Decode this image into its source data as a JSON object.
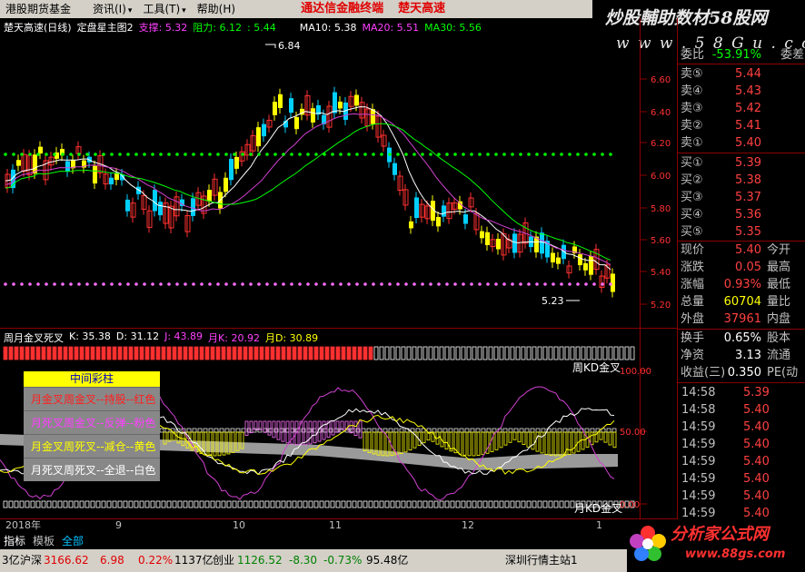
{
  "menubar": {
    "title": "港股期货基金",
    "menus": [
      "资讯(I)",
      "工具(T)",
      "帮助(H)"
    ],
    "banner1": "通达信金融终端",
    "banner2": "楚天高速"
  },
  "watermark": {
    "title": "炒股輔助数材58股网",
    "url": "w w w . 5 8 G u . c o m"
  },
  "price_header": {
    "name": "楚天高速(日线)",
    "indicator": "定盘星主图2",
    "support_label": "支撑:",
    "support_value": "5.32",
    "resist_label": "阻力:",
    "resist_value": "6.12",
    "extra": ": 5.44",
    "ma10": "MA10: 5.38",
    "ma20": "MA20: 5.51",
    "ma30": "MA30: 5.56"
  },
  "price_axis": {
    "ticks": [
      "6.60",
      "6.40",
      "6.20",
      "6.00",
      "5.80",
      "5.60",
      "5.40",
      "5.20"
    ]
  },
  "chart_annotations": {
    "high": "6.84",
    "low": "5.23"
  },
  "kd_header": {
    "name": "周月金叉死叉",
    "k": "K: 35.38",
    "d": "D: 31.12",
    "j": "J: 43.89",
    "mk": "月K: 20.92",
    "md": "月D: 30.89"
  },
  "sub_axis": {
    "ticks": [
      "100.00",
      "50.00",
      "0.00"
    ]
  },
  "sub_labels": {
    "week": "周KD金叉",
    "month": "月KD金叉"
  },
  "legend": {
    "header": "中间彩柱",
    "rows": [
      {
        "text": "月金叉周金叉--持股--红色",
        "color": "#ff2020"
      },
      {
        "text": "月死叉周金叉--反弹--粉色",
        "color": "#ff40ff"
      },
      {
        "text": "月金叉周死叉--减仓--黄色",
        "color": "#ffff00"
      },
      {
        "text": "月死叉周死叉--全退--白色",
        "color": "#ffffff"
      }
    ]
  },
  "time_axis": {
    "labels": [
      "2018年",
      "9",
      "10",
      "11",
      "12",
      "1"
    ]
  },
  "order_book": {
    "comparison": {
      "label": "委比",
      "value": "-53.91%",
      "label2": "委差"
    },
    "asks": [
      {
        "label": "卖⑤",
        "price": "5.44"
      },
      {
        "label": "卖④",
        "price": "5.43"
      },
      {
        "label": "卖③",
        "price": "5.42"
      },
      {
        "label": "卖②",
        "price": "5.41"
      },
      {
        "label": "卖①",
        "price": "5.40"
      }
    ],
    "bids": [
      {
        "label": "买①",
        "price": "5.39"
      },
      {
        "label": "买②",
        "price": "5.38"
      },
      {
        "label": "买③",
        "price": "5.37"
      },
      {
        "label": "买④",
        "price": "5.36"
      },
      {
        "label": "买⑤",
        "price": "5.35"
      }
    ]
  },
  "stats": [
    {
      "label": "现价",
      "value": "5.40",
      "label2": "今开"
    },
    {
      "label": "涨跌",
      "value": "0.05",
      "label2": "最高"
    },
    {
      "label": "涨幅",
      "value": "0.93%",
      "label2": "最低"
    },
    {
      "label": "总量",
      "value": "60704",
      "label2": "量比"
    },
    {
      "label": "外盘",
      "value": "37961",
      "label2": "内盘"
    }
  ],
  "stats2": [
    {
      "label": "换手",
      "value": "0.65%",
      "label2": "股本"
    },
    {
      "label": "净资",
      "value": "3.13",
      "label2": "流通"
    },
    {
      "label": "收益(三)",
      "value": "0.350",
      "label2": "PE(动"
    }
  ],
  "ticks": [
    {
      "time": "14:58",
      "price": "5.39"
    },
    {
      "time": "14:58",
      "price": "5.40"
    },
    {
      "time": "14:59",
      "price": "5.40"
    },
    {
      "time": "14:59",
      "price": "5.40"
    },
    {
      "time": "14:59",
      "price": "5.40"
    },
    {
      "time": "14:59",
      "price": "5.40"
    },
    {
      "time": "14:59",
      "price": "5.40"
    },
    {
      "time": "14:59",
      "price": "5.40"
    }
  ],
  "bottom_tabs": [
    "指标",
    "模板",
    "全部"
  ],
  "status_bar": {
    "prefix": "3亿",
    "index1_name": "沪深",
    "index1_value": "3166.62",
    "index1_change": "6.98",
    "index1_pct": "0.22%",
    "index1_vol": "1137亿",
    "index2_name": "创业",
    "index2_value": "1126.52",
    "index2_change": "-8.30",
    "index2_pct": "-0.73%",
    "index2_vol": "95.48亿",
    "station": "深圳行情主站1"
  },
  "logo": {
    "name": "分析家公式网",
    "url": "www.88gs.com"
  },
  "colors": {
    "up": "#ff3030",
    "down": "#00d0ff",
    "yellow": "#ffff00",
    "green_line": "#00ff00",
    "pink_line": "#ff70ff",
    "magenta": "#d040d0",
    "divider": "#8b0000"
  }
}
